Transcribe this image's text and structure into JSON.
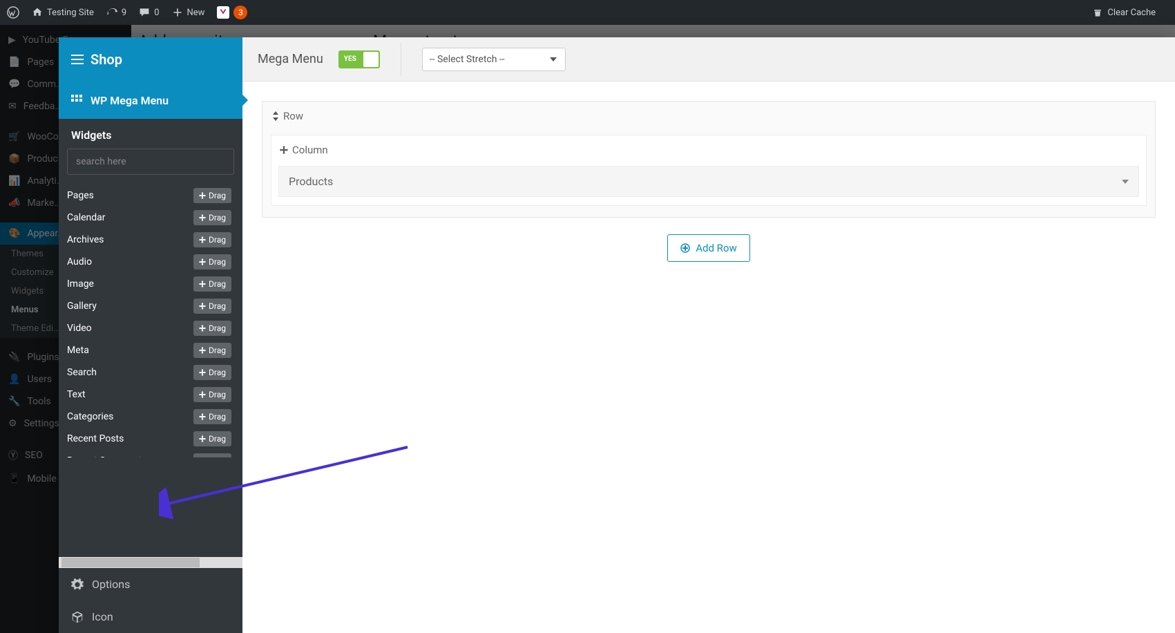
{
  "topbar": {
    "site_name": "Testing Site",
    "updates": "9",
    "comments": "0",
    "new_label": "New",
    "yoast_badge": "3",
    "clear_cache": "Clear Cache"
  },
  "underlayer": {
    "header_left": "Add menu items",
    "header_right": "Menu structure",
    "sidebar_items": [
      "YouTube Free",
      "Pages",
      "Comm…",
      "Feedba…",
      "WooCo…",
      "Produc…",
      "Analyti…",
      "Marke…",
      "Appear…"
    ],
    "appearance_sub": [
      "Themes",
      "Customize",
      "Widgets",
      "Menus",
      "Theme Edi…"
    ],
    "sidebar_items_after": [
      "Plugins",
      "Users",
      "Tools",
      "Settings",
      "SEO",
      "Mobile Options"
    ]
  },
  "mm": {
    "shop": "Shop",
    "tab": "WP Mega Menu",
    "widgets_header": "Widgets",
    "search_placeholder": "search here",
    "drag_label": "Drag",
    "widgets": [
      "Pages",
      "Calendar",
      "Archives",
      "Audio",
      "Image",
      "Gallery",
      "Video",
      "Meta",
      "Search",
      "Text",
      "Categories",
      "Recent Posts",
      "Recent Comments"
    ],
    "options_label": "Options",
    "icon_label": "Icon"
  },
  "editor": {
    "title": "Mega Menu",
    "switch_on": "YES",
    "select_default": "-- Select Stretch --",
    "row_label": "Row",
    "column_label": "Column",
    "widget_products": "Products",
    "add_row": "Add Row"
  }
}
